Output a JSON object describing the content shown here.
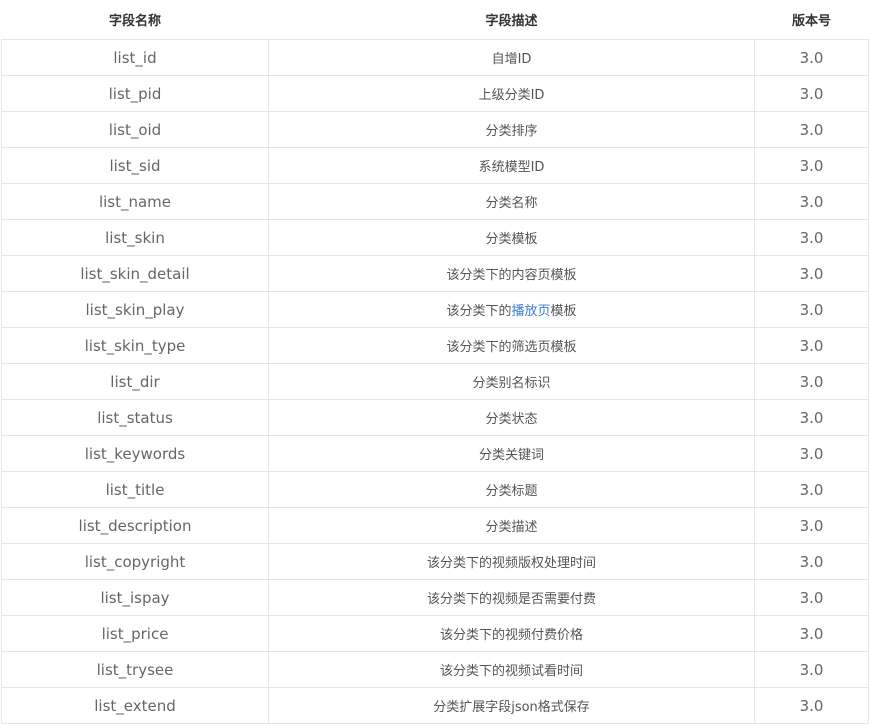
{
  "headers": {
    "name": "字段名称",
    "desc": "字段描述",
    "version": "版本号"
  },
  "link_color": "#3a7bd5",
  "rows": [
    {
      "name": "list_id",
      "desc": "自增ID",
      "version": "3.0"
    },
    {
      "name": "list_pid",
      "desc": "上级分类ID",
      "version": "3.0"
    },
    {
      "name": "list_oid",
      "desc": "分类排序",
      "version": "3.0"
    },
    {
      "name": "list_sid",
      "desc": "系统模型ID",
      "version": "3.0"
    },
    {
      "name": "list_name",
      "desc": "分类名称",
      "version": "3.0"
    },
    {
      "name": "list_skin",
      "desc": "分类模板",
      "version": "3.0"
    },
    {
      "name": "list_skin_detail",
      "desc": "该分类下的内容页模板",
      "version": "3.0"
    },
    {
      "name": "list_skin_play",
      "desc_pre": "该分类下的",
      "desc_link": "播放页",
      "desc_post": "模板",
      "version": "3.0"
    },
    {
      "name": "list_skin_type",
      "desc": "该分类下的筛选页模板",
      "version": "3.0"
    },
    {
      "name": "list_dir",
      "desc": "分类别名标识",
      "version": "3.0"
    },
    {
      "name": "list_status",
      "desc": "分类状态",
      "version": "3.0"
    },
    {
      "name": "list_keywords",
      "desc": "分类关键词",
      "version": "3.0"
    },
    {
      "name": "list_title",
      "desc": "分类标题",
      "version": "3.0"
    },
    {
      "name": "list_description",
      "desc": "分类描述",
      "version": "3.0"
    },
    {
      "name": "list_copyright",
      "desc": "该分类下的视频版权处理时间",
      "version": "3.0"
    },
    {
      "name": "list_ispay",
      "desc": "该分类下的视频是否需要付费",
      "version": "3.0"
    },
    {
      "name": "list_price",
      "desc": "该分类下的视频付费价格",
      "version": "3.0"
    },
    {
      "name": "list_trysee",
      "desc": "该分类下的视频试看时间",
      "version": "3.0"
    },
    {
      "name": "list_extend",
      "desc": "分类扩展字段json格式保存",
      "version": "3.0"
    }
  ]
}
